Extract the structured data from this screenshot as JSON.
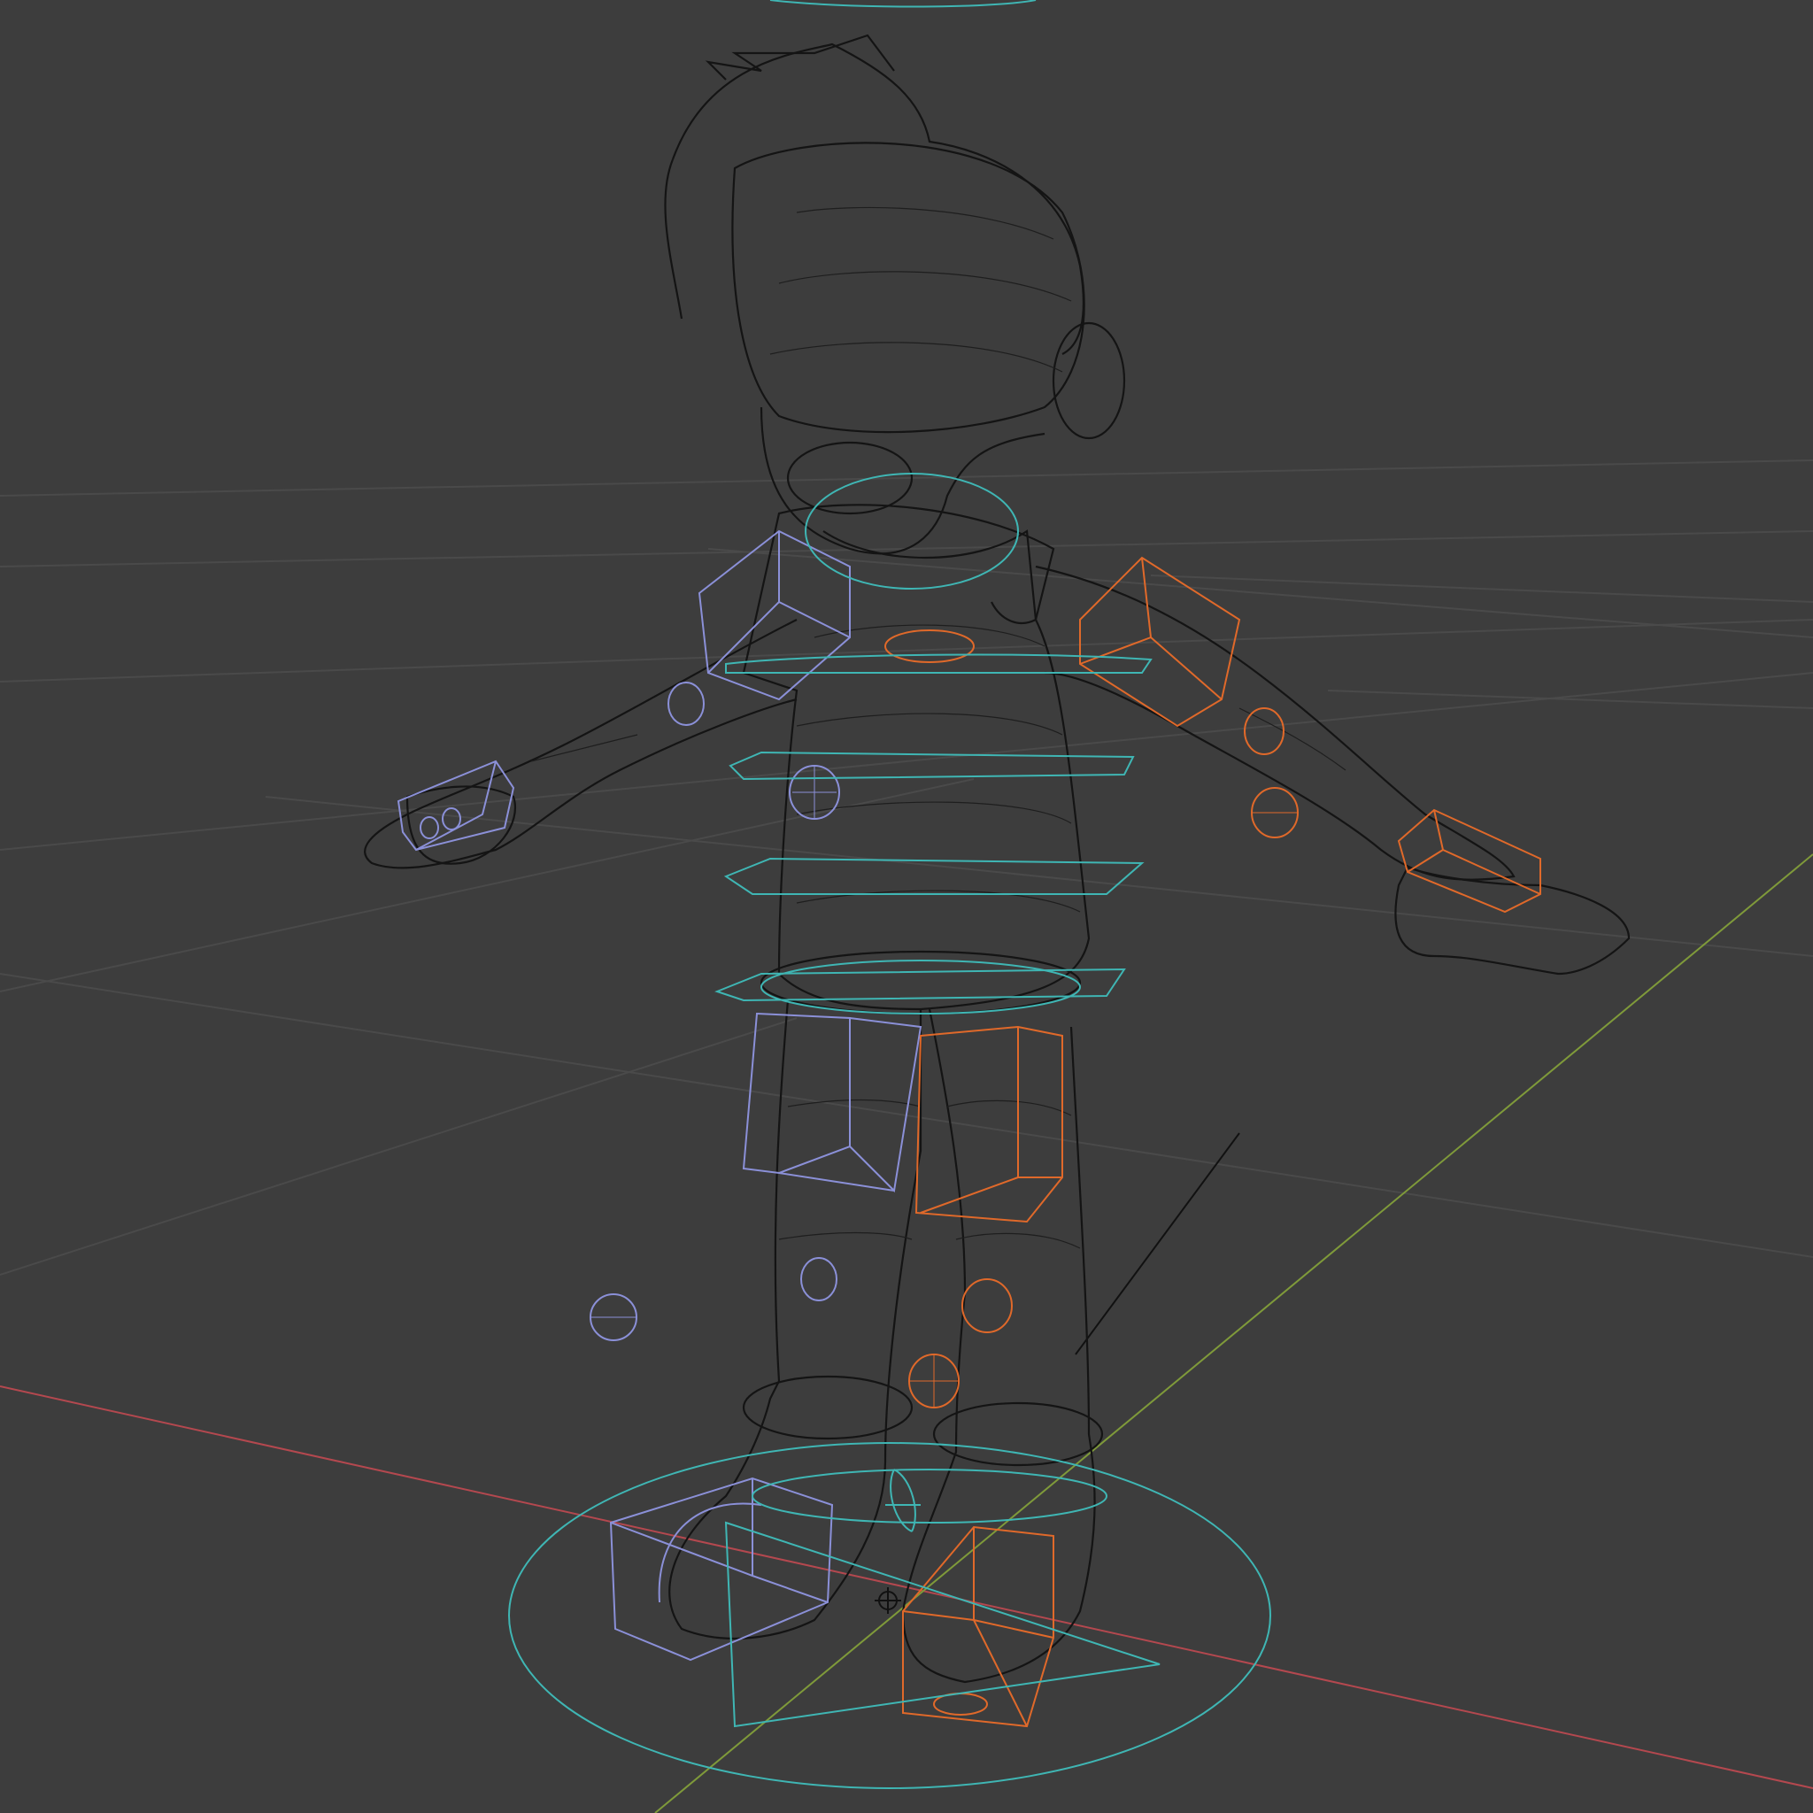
{
  "viewport": {
    "mode": "wireframe",
    "background": "#3d3d3d",
    "grid_color": "#4a4a4a"
  },
  "colors": {
    "mesh_wire": "#141414",
    "axis_x": "#b4484f",
    "axis_y": "#7f9a3a",
    "ctrl_left": "#8b90d8",
    "ctrl_right": "#e0692a",
    "ctrl_center": "#3fb6b4",
    "empty_line": "#111111"
  },
  "objects": [
    {
      "name": "character-mesh",
      "type": "mesh"
    },
    {
      "name": "armature-controls",
      "type": "armature"
    }
  ]
}
